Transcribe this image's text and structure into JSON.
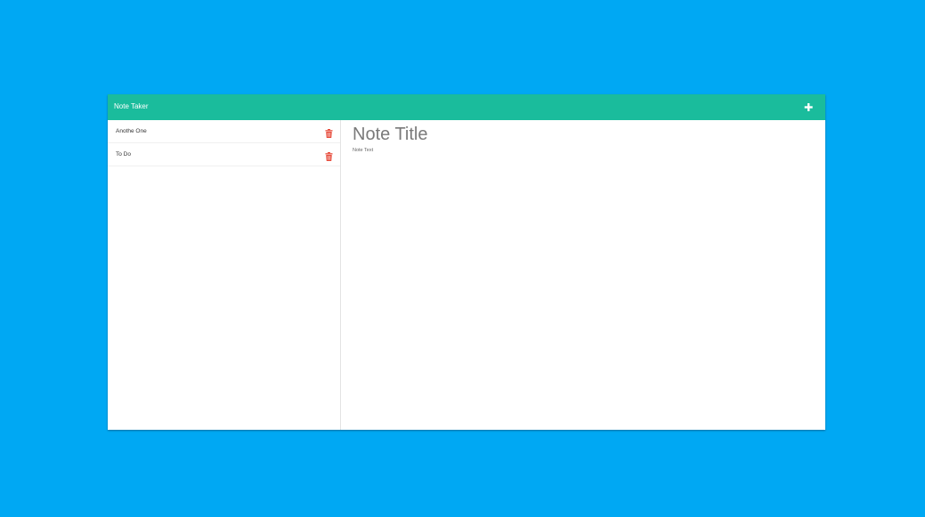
{
  "app": {
    "title": "Note Taker",
    "new_note_icon": "plus-icon"
  },
  "colors": {
    "background": "#00a8f3",
    "navbar": "#1abc9c",
    "delete_icon": "#e74c3c"
  },
  "sidebar": {
    "notes": [
      {
        "title": "Anothe One",
        "delete_icon": "trash-icon"
      },
      {
        "title": "To Do",
        "delete_icon": "trash-icon"
      }
    ]
  },
  "editor": {
    "title_placeholder": "Note Title",
    "text_placeholder": "Note Text"
  }
}
